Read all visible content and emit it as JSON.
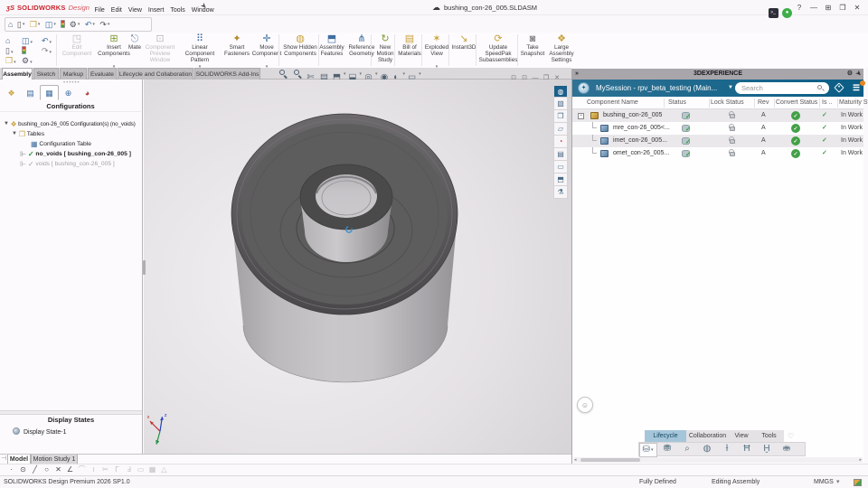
{
  "title_bar": {
    "logo_mark": "ʒS",
    "logo_brand": "SOLIDWORKS",
    "logo_product": "Design",
    "menus": [
      "File",
      "Edit",
      "View",
      "Insert",
      "Tools",
      "Window"
    ],
    "doc_name": "bushing_con-26_005.SLDASM"
  },
  "ribbon": {
    "buttons": [
      {
        "label": "Edit Component"
      },
      {
        "label": "Insert Components"
      },
      {
        "label": "Mate"
      },
      {
        "label": "Component Preview Window"
      },
      {
        "label": "Linear Component Pattern"
      },
      {
        "label": "Smart Fasteners"
      },
      {
        "label": "Move Component"
      },
      {
        "label": "Show Hidden Components"
      },
      {
        "label": "Assembly Features"
      },
      {
        "label": "Reference Geometry"
      },
      {
        "label": "New Motion Study"
      },
      {
        "label": "Bill of Materials"
      },
      {
        "label": "Exploded View"
      },
      {
        "label": "Instant3D"
      },
      {
        "label": "Update SpeedPak Subassemblies"
      },
      {
        "label": "Take Snapshot"
      },
      {
        "label": "Large Assembly Settings"
      }
    ]
  },
  "cmd_tabs": [
    {
      "label": "Assembly"
    },
    {
      "label": "Sketch"
    },
    {
      "label": "Markup"
    },
    {
      "label": "Evaluate"
    },
    {
      "label": "Lifecycle and Collaboration"
    },
    {
      "label": "SOLIDWORKS Add-Ins"
    }
  ],
  "left_panel": {
    "header": "Configurations",
    "tree": [
      {
        "label": "bushing_con-26_005 Configuration(s)  (no_voids)"
      },
      {
        "label": "Tables"
      },
      {
        "label": "Configuration Table"
      },
      {
        "label": "no_voids [ bushing_con-26_005 ]"
      },
      {
        "label": "voids [ bushing_con-26_005 ]"
      }
    ],
    "display_states_header": "Display States",
    "display_state": "Display State-1"
  },
  "right_panel": {
    "title": "3DEXPERIENCE",
    "session": "MySession - rpv_beta_testing (Main...",
    "search_placeholder": "Search",
    "columns": [
      "Component Name",
      "Status",
      "Lock Status",
      "Rev",
      "Convert Status",
      "Is ..",
      "Maturity Stat"
    ],
    "rows": [
      {
        "name": "bushing_con-26_005",
        "rev": "A",
        "maturity": "In Work"
      },
      {
        "name": "mre_con-26_005<...",
        "rev": "A",
        "maturity": "In Work"
      },
      {
        "name": "imet_con-26_005...",
        "rev": "A",
        "maturity": "In Work"
      },
      {
        "name": "omet_con-26_005...",
        "rev": "A",
        "maturity": "In Work"
      }
    ],
    "tabs": [
      "Lifecycle",
      "Collaboration",
      "View",
      "Tools"
    ]
  },
  "bottom_bar": {
    "model_tabs": [
      "Model",
      "Motion Study 1"
    ],
    "app_version": "SOLIDWORKS Design Premium 2026 SP1.0",
    "status_items": [
      "Fully Defined",
      "Editing Assembly"
    ],
    "units": "MMGS"
  }
}
